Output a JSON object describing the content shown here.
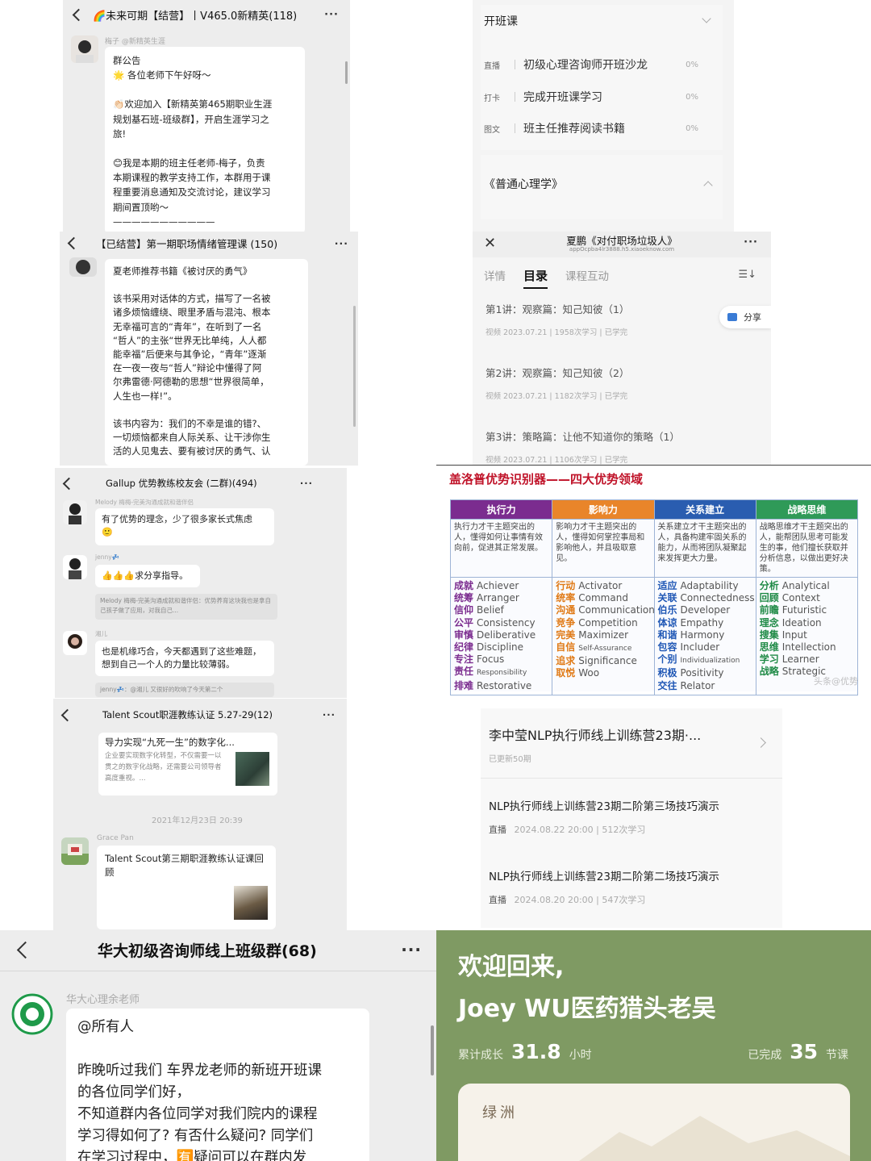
{
  "panels": {
    "chat1": {
      "title": "🌈未来可期【结营】丨V465.0新精英(118)",
      "sender_nick": "梅子 @新精英生涯",
      "message_lines": [
        "群公告",
        "🌟 各位老师下午好呀～",
        "",
        "👏🏻欢迎加入【新精英第465期职业生涯",
        "规划基石班-班级群】，开启生涯学习之",
        "旅!",
        "",
        "😊我是本期的班主任老师-梅子，负责",
        "本期课程的教学支持工作，本群用于课",
        "程重要消息通知及交流讨论，建议学习",
        "期间置顶哟～",
        "———————————"
      ]
    },
    "chat2": {
      "title": "【已结营】第一期职场情绪管理课 (150)",
      "message_lines": [
        "夏老师推荐书籍《被讨厌的勇气》",
        "",
        "该书采用对话体的方式，描写了一名被",
        "诸多烦恼缠绕、眼里矛盾与混沌、根本",
        "无幸福可言的“青年”，在听到了一名",
        "“哲人”的主张“世界无比单纯，人人都",
        "能幸福”后便来与其争论，“青年”逐渐",
        "在一夜一夜与“哲人”辩论中懂得了阿",
        "尔弗雷德·阿德勒的思想“世界很简单，",
        "人生也一样!”。",
        "",
        "该书内容为：我们的不幸是谁的错?、",
        "一切烦恼都来自人际关系、让干涉你生",
        "活的人见鬼去、要有被讨厌的勇气、认"
      ]
    },
    "chat3": {
      "title": "Gallup 优势教练校友会 (二群)(494)",
      "m1_nick": "Melody 梅梅-完美沟通成就和谐伴侣",
      "m1_text": "有了优势的理念，少了很多家长式焦虑",
      "m1_emoji": "🙂",
      "m2_nick": "jenny💤",
      "m2_text": "👍👍👍求分享指导。",
      "m2_quote": "Melody 梅梅-完美沟通成就和谐伴侣：优势养育这块我也是拿自己孩子做了应用，对我自己...",
      "m3_nick": "湘儿",
      "m3_text": "也是机缘巧合，今天都遇到了这些难题，想到自己一个人的力量比较薄弱。",
      "m3_quote": "jenny💤：@湘儿 又很好的吹响了今天第二个"
    },
    "chat4": {
      "title": "Talent Scout职涯教练认证 5.27-29(12)",
      "card1_title": "导力实现“九死一生”的数字化...",
      "card1_desc": "企业要实现数字化转型，不仅需要一以贯之的数字化战略，还需要公司领导者高度重视。...",
      "timestamp": "2021年12月23日 20:39",
      "sender_nick": "Grace Pan",
      "card2_title": "Talent Scout第三期职涯教练认证课回顾"
    },
    "chat5": {
      "title": "华大初级咨询师线上班级群(68)",
      "sender_nick": "华大心理余老师",
      "message_lines": [
        "@所有人",
        "",
        "昨晚听过我们 车界龙老师的新班开班课",
        "的各位同学们好，",
        "不知道群内各位同学对我们院内的课程",
        "学习得如何了? 有否什么疑问? 同学们",
        "在学习过程中，🈶疑问可以在群内发"
      ]
    },
    "course_list": {
      "section1": "开班课",
      "rows": [
        {
          "tag": "直播",
          "label": "初级心理咨询师开班沙龙",
          "pct": "0%"
        },
        {
          "tag": "打卡",
          "label": "完成开班课学习",
          "pct": "0%"
        },
        {
          "tag": "图文",
          "label": "班主任推荐阅读书籍",
          "pct": "0%"
        }
      ],
      "section2": "《普通心理学》"
    },
    "xiaoe": {
      "title": "夏鹏《对付职场垃圾人》",
      "subtitle": "appOcpba4lr3888.h5.xiaoeknow.com",
      "tabs": [
        "详情",
        "目录",
        "课程互动"
      ],
      "share": "分享",
      "lessons": [
        {
          "title": "第1讲：观察篇：知己知彼（1）",
          "meta": "视频  2023.07.21 | 1958次学习 | 已学完"
        },
        {
          "title": "第2讲：观察篇：知己知彼（2）",
          "meta": "视频  2023.07.21 | 1182次学习 | 已学完"
        },
        {
          "title": "第3讲：策略篇：让他不知道你的策略（1）",
          "meta": "视频  2023.07.21 | 1106次学习 | 已学完"
        }
      ]
    },
    "gallup": {
      "title": "盖洛普优势识别器——四大优势领域",
      "watermark": "头条@优势",
      "columns": [
        {
          "head": "执行力",
          "color": "#7b2c8f",
          "text_color": "#7b2c8f",
          "desc": "执行力才干主题突出的人，懂得如何让事情有效向前，促进其正常发展。",
          "items": [
            [
              "成就",
              "Achiever"
            ],
            [
              "统筹",
              "Arranger"
            ],
            [
              "信仰",
              "Belief"
            ],
            [
              "公平",
              "Consistency"
            ],
            [
              "审慎",
              "Deliberative"
            ],
            [
              "纪律",
              "Discipline"
            ],
            [
              "专注",
              "Focus"
            ],
            [
              "责任",
              "Responsibility"
            ],
            [
              "排难",
              "Restorative"
            ]
          ]
        },
        {
          "head": "影响力",
          "color": "#e9852a",
          "text_color": "#e07a16",
          "desc": "影响力才干主题突出的人，懂得如何掌控事局和影响他人，并且吸取意见。",
          "items": [
            [
              "行动",
              "Activator"
            ],
            [
              "统率",
              "Command"
            ],
            [
              "沟通",
              "Communication"
            ],
            [
              "竞争",
              "Competition"
            ],
            [
              "完美",
              "Maximizer"
            ],
            [
              "自信",
              "Self-Assurance"
            ],
            [
              "追求",
              "Significance"
            ],
            [
              "取悦",
              "Woo"
            ]
          ]
        },
        {
          "head": "关系建立",
          "color": "#2a5db0",
          "text_color": "#1f57b5",
          "desc": "关系建立才干主题突出的人，具备构建牢固关系的能力，从而将团队凝聚起来发挥更大力量。",
          "items": [
            [
              "适应",
              "Adaptability"
            ],
            [
              "关联",
              "Connectedness"
            ],
            [
              "伯乐",
              "Developer"
            ],
            [
              "体谅",
              "Empathy"
            ],
            [
              "和谐",
              "Harmony"
            ],
            [
              "包容",
              "Includer"
            ],
            [
              "个别",
              "Individualization"
            ],
            [
              "积极",
              "Positivity"
            ],
            [
              "交往",
              "Relator"
            ]
          ]
        },
        {
          "head": "战略思维",
          "color": "#2f9a58",
          "text_color": "#1f8a46",
          "desc": "战略思维才干主题突出的人，能帮团队思考可能发生的事，他们擅长获取并分析信息，以做出更好决策。",
          "items": [
            [
              "分析",
              "Analytical"
            ],
            [
              "回顾",
              "Context"
            ],
            [
              "前瞻",
              "Futuristic"
            ],
            [
              "理念",
              "Ideation"
            ],
            [
              "搜集",
              "Input"
            ],
            [
              "思维",
              "Intellection"
            ],
            [
              "学习",
              "Learner"
            ],
            [
              "战略",
              "Strategic"
            ]
          ]
        }
      ]
    },
    "nlp": {
      "series_title": "李中莹NLP执行师线上训练营23期·...",
      "series_meta": "已更新50期",
      "items": [
        {
          "title": "NLP执行师线上训练营23期二阶第三场技巧演示",
          "tag": "直播",
          "meta": "2024.08.22 20:00 | 512次学习"
        },
        {
          "title": "NLP执行师线上训练营23期二阶第二场技巧演示",
          "tag": "直播",
          "meta": "2024.08.20 20:00 | 547次学习"
        }
      ]
    },
    "welcome": {
      "line1": "欢迎回来,",
      "line2": "Joey WU医药猎头老吴",
      "growth_label": "累计成长",
      "growth_value": "31.8",
      "growth_unit": "小时",
      "done_label": "已完成",
      "done_value": "35",
      "done_unit": "节课",
      "card_logo": "绿洲"
    }
  }
}
